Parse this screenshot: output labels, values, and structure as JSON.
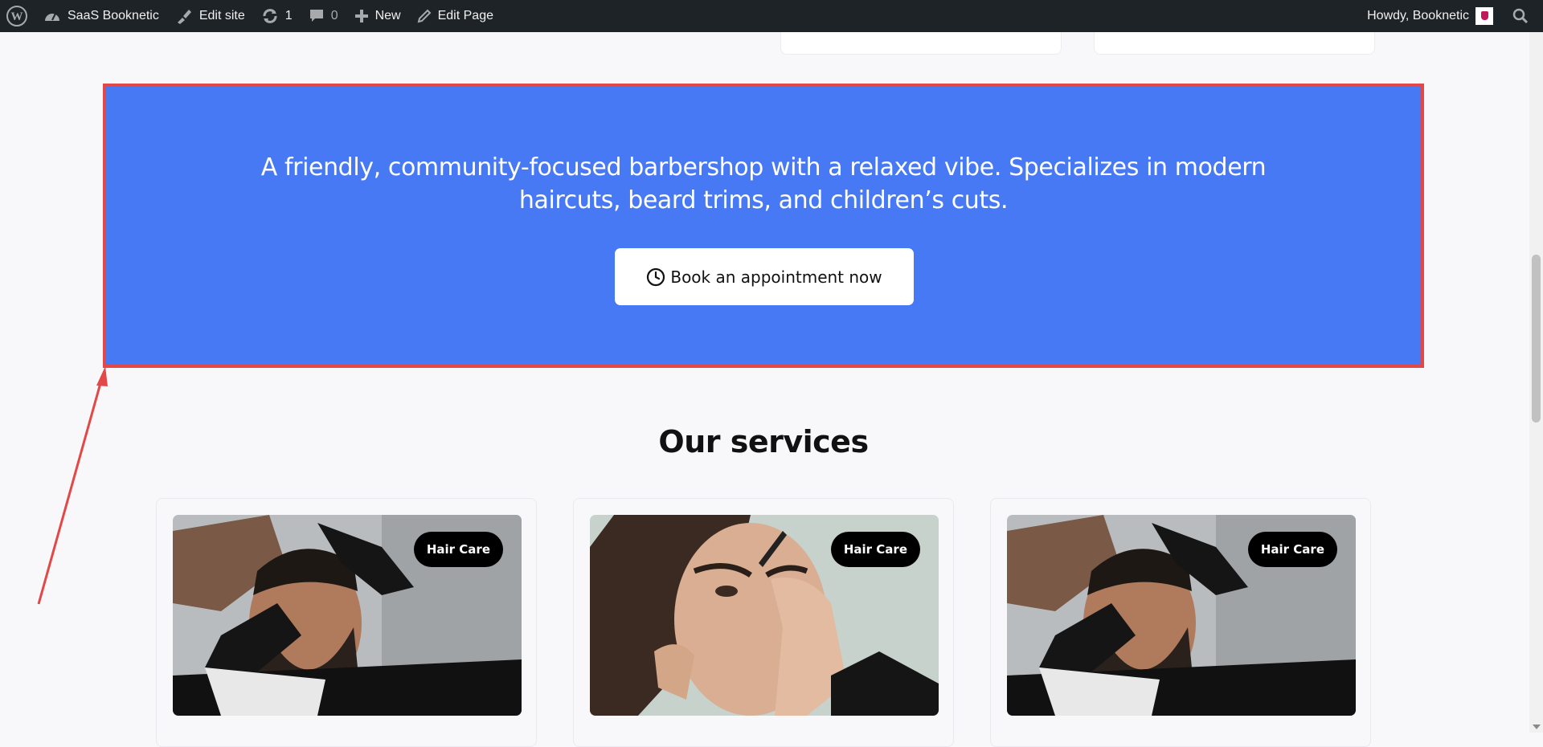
{
  "adminbar": {
    "site_name": "SaaS Booknetic",
    "edit_site": "Edit site",
    "updates_count": "1",
    "comments_count": "0",
    "new_label": "New",
    "edit_page": "Edit Page",
    "howdy": "Howdy, Booknetic"
  },
  "cta": {
    "text": "A friendly, community-focused barbershop with a relaxed vibe. Specializes in modern haircuts, beard trims, and children’s cuts.",
    "button_label": "Book an appointment now",
    "bg_color": "#4779f5",
    "highlight_color": "#e34848"
  },
  "services": {
    "title": "Our services",
    "cards": [
      {
        "badge": "Hair Care",
        "image": "barber-beard-trim-photo"
      },
      {
        "badge": "Hair Care",
        "image": "eyebrow-grooming-photo"
      },
      {
        "badge": "Hair Care",
        "image": "barber-beard-trim-photo"
      }
    ]
  }
}
